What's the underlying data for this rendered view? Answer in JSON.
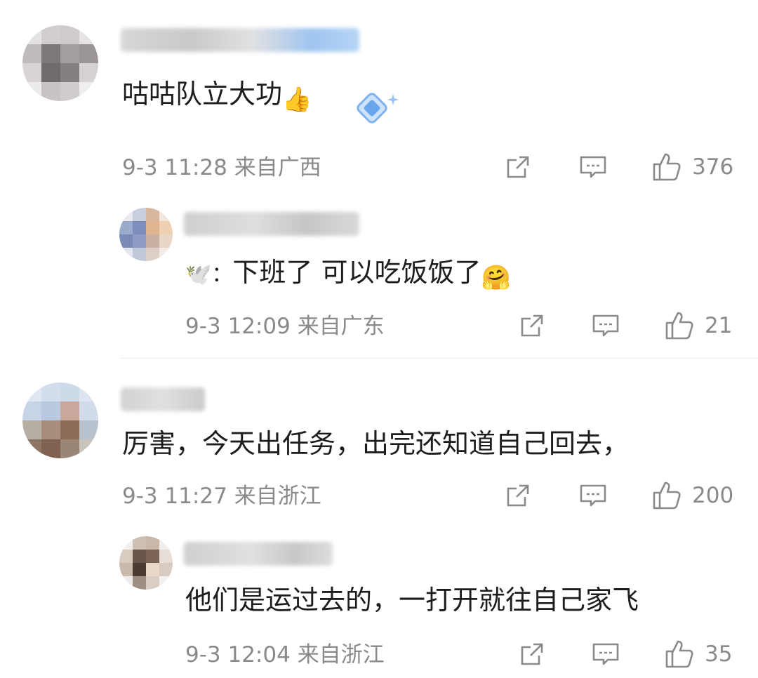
{
  "comments": [
    {
      "text": "咕咕队立大功",
      "emoji": "👍",
      "time": "9-3 11:28",
      "location": "来自广西",
      "likes": "376",
      "reply": {
        "prefix": "🕊️：",
        "text": "下班了  可以吃饭饭了",
        "emoji": "🤗",
        "time": "9-3 12:09",
        "location": "来自广东",
        "likes": "21"
      }
    },
    {
      "text": "厉害，今天出任务，出完还知道自己回去，",
      "time": "9-3 11:27",
      "location": "来自浙江",
      "likes": "200",
      "reply": {
        "text": "他们是运过去的，一打开就往自己家飞",
        "time": "9-3 12:04",
        "location": "来自浙江",
        "likes": "35"
      }
    }
  ],
  "icons": [
    "share-icon",
    "comment-icon",
    "like-icon",
    "blurred-avatar",
    "badge-icon"
  ],
  "colors": {
    "meta_gray": "#8a8a8a",
    "text": "#1d1d1d",
    "divider": "#ececec"
  }
}
